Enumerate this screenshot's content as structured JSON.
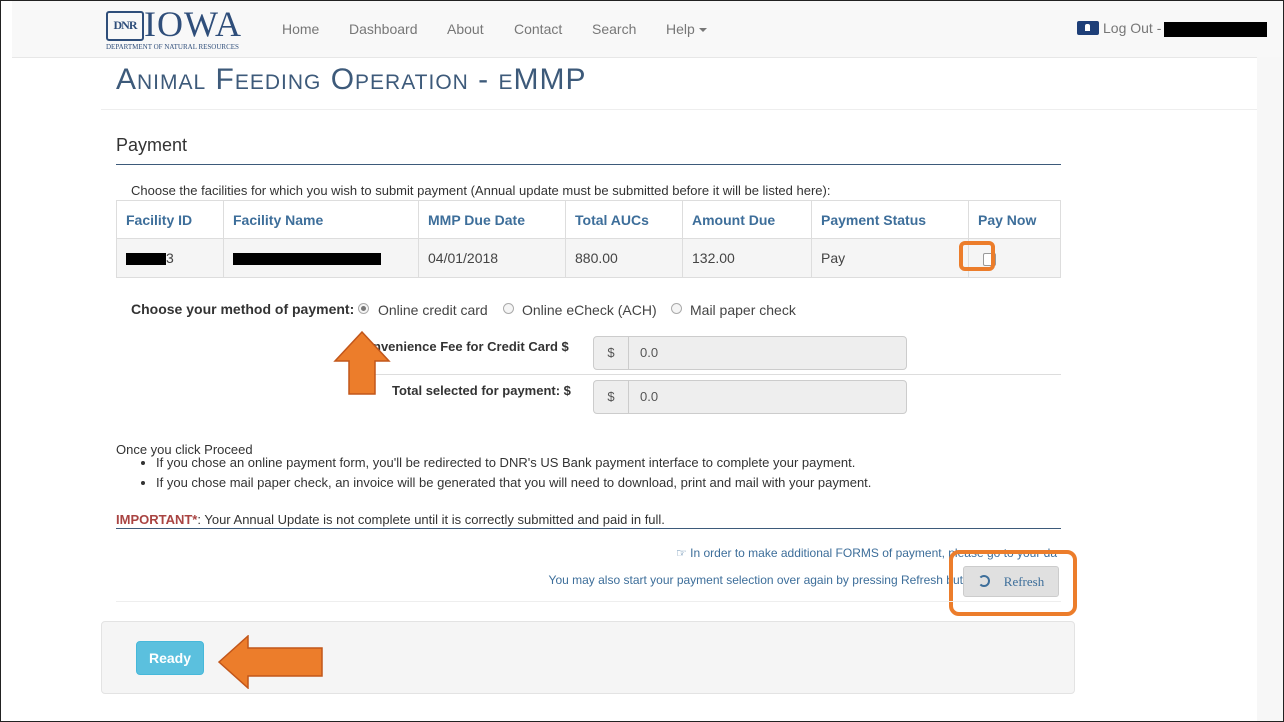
{
  "navbar": {
    "logo_box": "DNR",
    "logo_word": "IOWA",
    "logo_sub": "DEPARTMENT OF NATURAL RESOURCES",
    "items": [
      "Home",
      "Dashboard",
      "About",
      "Contact",
      "Search",
      "Help"
    ],
    "logout_label": "Log Out -"
  },
  "page": {
    "title": "Animal Feeding Operation - eMMP",
    "section_title": "Payment",
    "instructions": "Choose the facilities for which you wish to submit payment (Annual update must be submitted before it will be listed here):"
  },
  "table": {
    "headers": [
      "Facility ID",
      "Facility Name",
      "MMP Due Date",
      "Total AUCs",
      "Amount Due",
      "Payment Status",
      "Pay Now"
    ],
    "rows": [
      {
        "facility_id_suffix": "3",
        "facility_name": "",
        "due_date": "04/01/2018",
        "total_aucs": "880.00",
        "amount_due": "132.00",
        "payment_status": "Pay",
        "pay_now_checked": false
      }
    ]
  },
  "payment_method": {
    "label": "Choose your method of payment:",
    "options": [
      "Online credit card",
      "Online eCheck (ACH)",
      "Mail paper check"
    ],
    "selected": "Online credit card"
  },
  "fees": {
    "convenience_label": "nvenience Fee for Credit Card $",
    "total_label": "Total selected for payment: $",
    "currency": "$",
    "convenience_value": "0.0",
    "total_value": "0.0"
  },
  "notes": {
    "once": "Once you click Proceed",
    "bullets": [
      "If you chose an online payment form, you'll be redirected to DNR's US Bank payment interface to complete your payment.",
      "If you chose mail paper check, an invoice will be generated that you will need to download, print and mail with your payment."
    ],
    "important_prefix": "IMPORTANT*",
    "important_text": ": Your Annual Update is not complete until it is correctly submitted and paid in full.",
    "info1": "☞ In order to make additional FORMS of payment, please go to your da",
    "info2": "You may also start your payment selection over again by pressing Refresh butto"
  },
  "buttons": {
    "refresh": "Refresh",
    "ready": "Ready"
  },
  "colors": {
    "highlight": "#ec7d2b",
    "title": "#3d5a7a",
    "link": "#3d6e9a",
    "ready": "#5bc0de"
  }
}
